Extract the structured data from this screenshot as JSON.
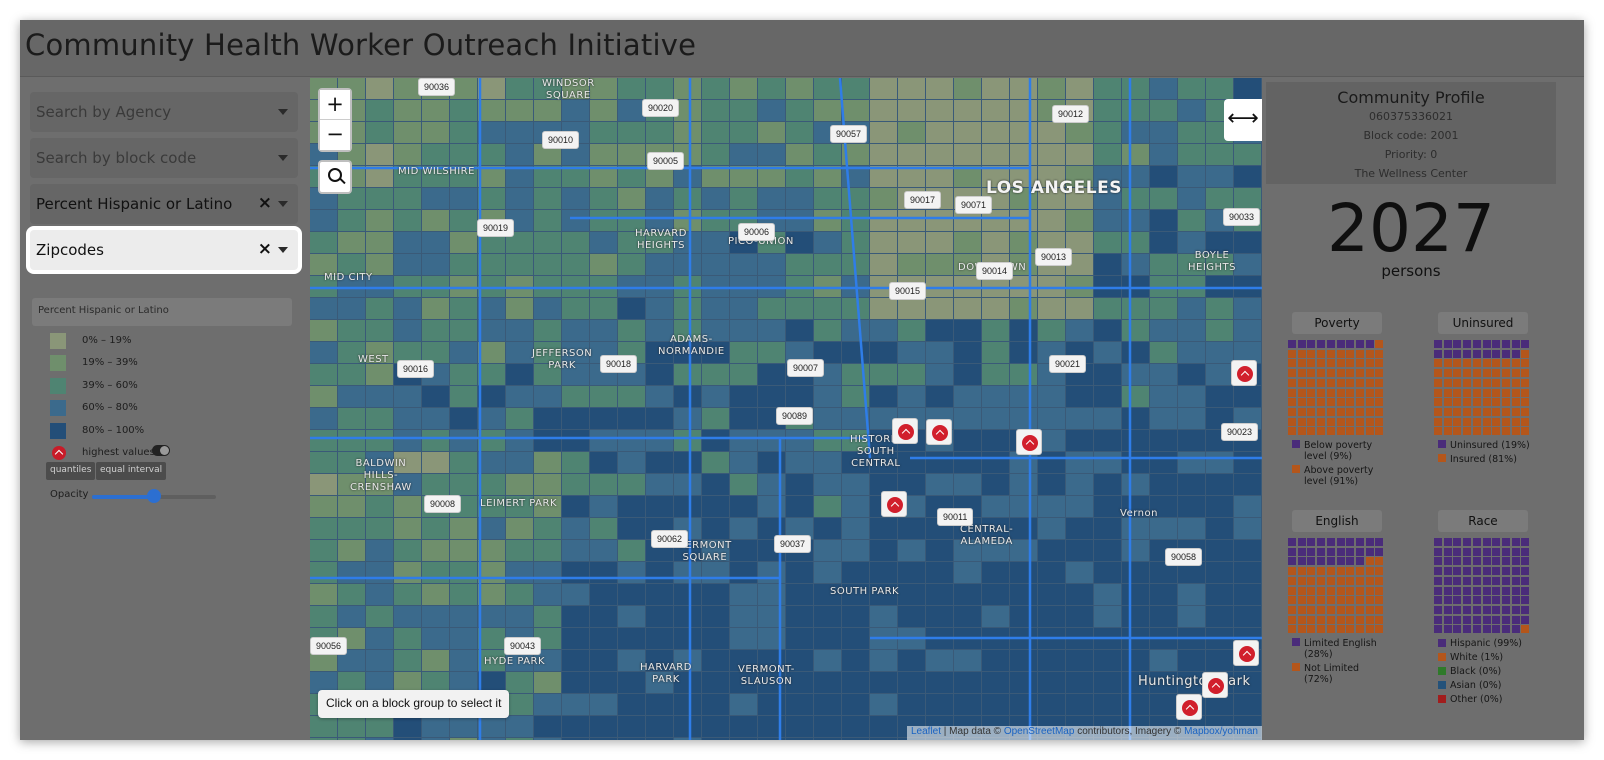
{
  "app": {
    "title": "Community Health Worker Outreach Initiative"
  },
  "sidebar": {
    "agency_placeholder": "Search by Agency",
    "block_placeholder": "Search by block code",
    "variable_value": "Percent Hispanic or Latino",
    "overlay_value": "Zipcodes",
    "clear_icon": "×"
  },
  "legend": {
    "title": "Percent Hispanic or Latino",
    "bins": [
      {
        "label": "0% – 19%",
        "color": "#8a9678"
      },
      {
        "label": "19% – 39%",
        "color": "#6f8f6c"
      },
      {
        "label": "39% – 60%",
        "color": "#4f8472"
      },
      {
        "label": "60% – 80%",
        "color": "#3b6a8c"
      },
      {
        "label": "80% – 100%",
        "color": "#234e78"
      }
    ],
    "highest_values_label": "highest values",
    "highest_values_toggle_on": true,
    "btn_quantiles": "quantiles",
    "btn_equal_interval": "equal interval",
    "opacity_label": "Opacity",
    "opacity_value": 0.5
  },
  "map": {
    "zoom_in": "+",
    "zoom_out": "−",
    "expand_glyph": "⟷",
    "click_hint": "Click on a block group to select it",
    "attribution": {
      "leaflet": "Leaflet",
      "sep1": " | Map data © ",
      "osm": "OpenStreetMap",
      "sep2": " contributors, Imagery © ",
      "mapbox": "Mapbox/yohman"
    },
    "zips": [
      {
        "code": "90036"
      },
      {
        "code": "90020"
      },
      {
        "code": "90010"
      },
      {
        "code": "90057"
      },
      {
        "code": "90012"
      },
      {
        "code": "90005"
      },
      {
        "code": "90017"
      },
      {
        "code": "90071"
      },
      {
        "code": "90033"
      },
      {
        "code": "90019"
      },
      {
        "code": "90006"
      },
      {
        "code": "90013"
      },
      {
        "code": "90014"
      },
      {
        "code": "90015"
      },
      {
        "code": "90016"
      },
      {
        "code": "90018"
      },
      {
        "code": "90007"
      },
      {
        "code": "90021"
      },
      {
        "code": "90089"
      },
      {
        "code": "90023"
      },
      {
        "code": "90008"
      },
      {
        "code": "90011"
      },
      {
        "code": "90062"
      },
      {
        "code": "90037"
      },
      {
        "code": "90058"
      },
      {
        "code": "90043"
      },
      {
        "code": "90056"
      }
    ],
    "place_labels": [
      {
        "text": "WINDSOR\nSQUARE"
      },
      {
        "text": "MID WILSHIRE"
      },
      {
        "text": "LOS ANGELES"
      },
      {
        "text": "HARVARD\nHEIGHTS"
      },
      {
        "text": "PICO-UNION"
      },
      {
        "text": "DOWNTOWN"
      },
      {
        "text": "BOYLE\nHEIGHTS"
      },
      {
        "text": "MID CITY"
      },
      {
        "text": "WEST"
      },
      {
        "text": "JEFFERSON\nPARK"
      },
      {
        "text": "ADAMS-\nNORMANDIE"
      },
      {
        "text": "HISTORIC\nSOUTH\nCENTRAL"
      },
      {
        "text": "BALDWIN\nHILLS-\nCRENSHAW"
      },
      {
        "text": "LEIMERT PARK"
      },
      {
        "text": "VERMONT\nSQUARE"
      },
      {
        "text": "CENTRAL-\nALAMEDA"
      },
      {
        "text": "Vernon"
      },
      {
        "text": "SOUTH PARK"
      },
      {
        "text": "HYDE PARK"
      },
      {
        "text": "HARVARD\nPARK"
      },
      {
        "text": "VERMONT-\nSLAUSON"
      },
      {
        "text": "Huntington Park"
      }
    ]
  },
  "profile": {
    "title": "Community Profile",
    "geoid": "060375336021",
    "block_code": "Block code: 2001",
    "priority": "Priority: 0",
    "agency": "The Wellness Center",
    "population": "2027",
    "population_unit": "persons"
  },
  "waffles": [
    {
      "title": "Poverty",
      "segments": [
        {
          "label": "Below poverty level (9%)",
          "value": 9,
          "color": "#4a2c7a"
        },
        {
          "label": "Above poverty level (91%)",
          "value": 91,
          "color": "#b4561b"
        }
      ]
    },
    {
      "title": "Uninsured",
      "segments": [
        {
          "label": "Uninsured (19%)",
          "value": 19,
          "color": "#4a2c7a"
        },
        {
          "label": "Insured (81%)",
          "value": 81,
          "color": "#b4561b"
        }
      ]
    },
    {
      "title": "English",
      "segments": [
        {
          "label": "Limited English (28%)",
          "value": 28,
          "color": "#4a2c7a"
        },
        {
          "label": "Not Limited (72%)",
          "value": 72,
          "color": "#b4561b"
        }
      ]
    },
    {
      "title": "Race",
      "segments": [
        {
          "label": "Hispanic (99%)",
          "value": 99,
          "color": "#4a2c7a"
        },
        {
          "label": "White (1%)",
          "value": 1,
          "color": "#b4561b"
        },
        {
          "label": "Black (0%)",
          "value": 0,
          "color": "#2f7a2a"
        },
        {
          "label": "Asian (0%)",
          "value": 0,
          "color": "#24527a"
        },
        {
          "label": "Other (0%)",
          "value": 0,
          "color": "#a11d1d"
        }
      ]
    }
  ]
}
